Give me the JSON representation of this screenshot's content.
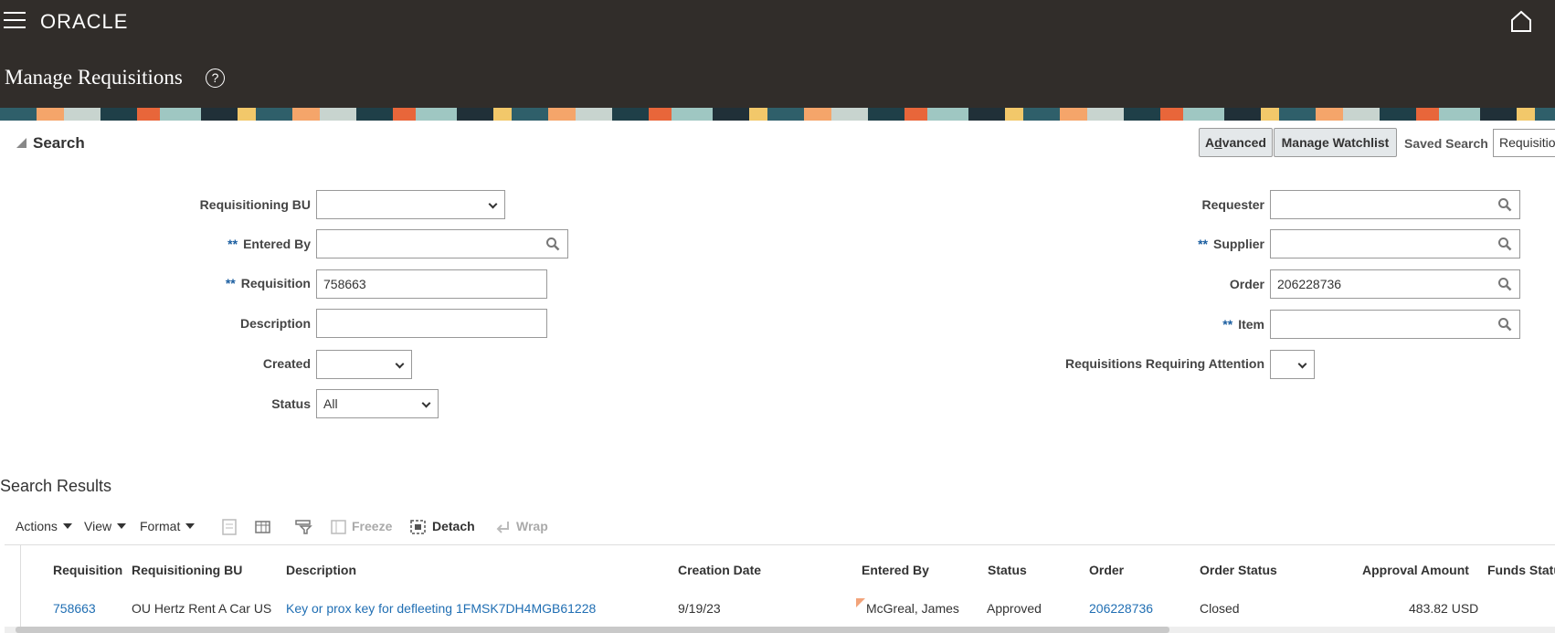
{
  "header": {
    "brand": "ORACLE",
    "page_title": "Manage Requisitions",
    "help_symbol": "?"
  },
  "search": {
    "section_title": "Search",
    "advanced_label": "Advanced",
    "advanced_mnemonic_prefix": "A",
    "advanced_mnemonic_char": "d",
    "advanced_mnemonic_rest": "vanced",
    "manage_watchlist_label": "Manage Watchlist",
    "saved_search_label": "Saved Search",
    "saved_search_value": "Requisitions",
    "required_marker": "**",
    "fields": {
      "requisitioning_bu": {
        "label": "Requisitioning BU",
        "value": ""
      },
      "entered_by": {
        "label": "Entered By",
        "value": ""
      },
      "requisition": {
        "label": "Requisition",
        "value": "758663"
      },
      "description": {
        "label": "Description",
        "value": ""
      },
      "created": {
        "label": "Created",
        "value": ""
      },
      "status": {
        "label": "Status",
        "value": "All"
      },
      "requester": {
        "label": "Requester",
        "value": ""
      },
      "supplier": {
        "label": "Supplier",
        "value": ""
      },
      "order": {
        "label": "Order",
        "value": "206228736"
      },
      "item": {
        "label": "Item",
        "value": ""
      },
      "attention": {
        "label": "Requisitions Requiring Attention",
        "value": ""
      }
    }
  },
  "results": {
    "title": "Search Results",
    "toolbar": {
      "actions": "Actions",
      "view": "View",
      "format": "Format",
      "freeze": "Freeze",
      "detach": "Detach",
      "wrap": "Wrap"
    },
    "columns": [
      "Requisition",
      "Requisitioning BU",
      "Description",
      "Creation Date",
      "Entered By",
      "Status",
      "Order",
      "Order Status",
      "Approval Amount",
      "Funds Status"
    ],
    "rows": [
      {
        "requisition": "758663",
        "bu": "OU Hertz Rent A Car US",
        "description": "Key or prox key for defleeting 1FMSK7DH4MGB61228",
        "creation_date": "9/19/23",
        "entered_by": "McGreal, James",
        "status": "Approved",
        "order": "206228736",
        "order_status": "Closed",
        "amount": "483.82",
        "currency": "USD"
      }
    ]
  },
  "colors": {
    "header_bg": "#312d2a",
    "link": "#1f6eb3",
    "required": "#1b5ea0"
  }
}
